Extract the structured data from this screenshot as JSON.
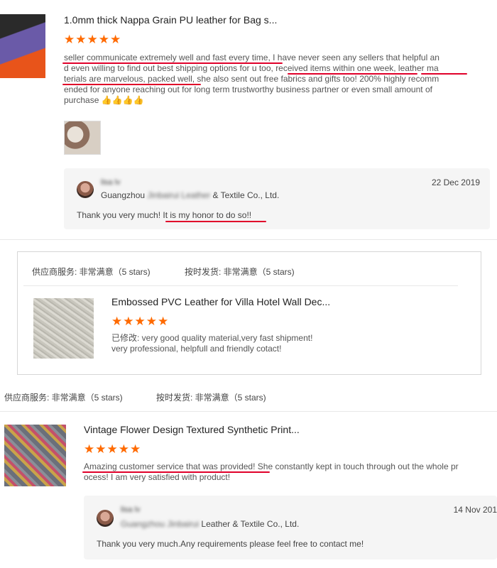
{
  "review1": {
    "title": "1.0mm thick Nappa Grain PU leather for Bag s...",
    "stars": "★★★★★",
    "lines": [
      "seller communicate extremely well and fast every time, I have never seen any sellers that helpful an",
      "d even willing to find out best shipping options for u too, received items within one week, leather ma",
      "terials are marvelous, packed well, she also sent out free fabrics and gifts too! 200% highly recomm",
      "ended for anyone reaching out for long term trustworthy business partner or even small amount of",
      "purchase 👍👍👍👍"
    ],
    "reply": {
      "name": "lisa lv",
      "company_blurred": "Jinbairui Leather",
      "company_rest": "& Textile Co., Ltd.",
      "company_prefix": "Guangzhou",
      "date": "22 Dec 2019",
      "text": "Thank you very much!  It is my honor to do so!!"
    }
  },
  "panel": {
    "supplier_service": "供应商服务: 非常满意（5 stars)",
    "on_time": "按时发货: 非常满意（5 stars)",
    "product_title": "Embossed PVC Leather for Villa Hotel Wall Dec...",
    "stars": "★★★★★",
    "line1": "已修改: very good quality material,very fast shipment!",
    "line2": "very professional, helpfull and friendly cotact!"
  },
  "ratings_row": {
    "supplier_service": "供应商服务: 非常满意（5 stars)",
    "on_time": "按时发货: 非常满意（5 stars)"
  },
  "review2": {
    "title": "Vintage Flower Design Textured Synthetic Print...",
    "stars": "★★★★★",
    "lines": [
      "Amazing customer service that was provided! She constantly kept in touch through out the whole pr",
      "ocess! I am very satisfied with product!"
    ],
    "reply": {
      "name": "lisa lv",
      "company_blurred": "Guangzhou Jinbairui",
      "company_rest": "Leather & Textile Co., Ltd.",
      "date": "14 Nov 201",
      "text": "Thank you very much.Any requirements please feel free to contact me!"
    }
  },
  "colors": {
    "star": "#ff6a00",
    "underline": "#e0002a",
    "reply_bg": "#f5f5f5"
  }
}
